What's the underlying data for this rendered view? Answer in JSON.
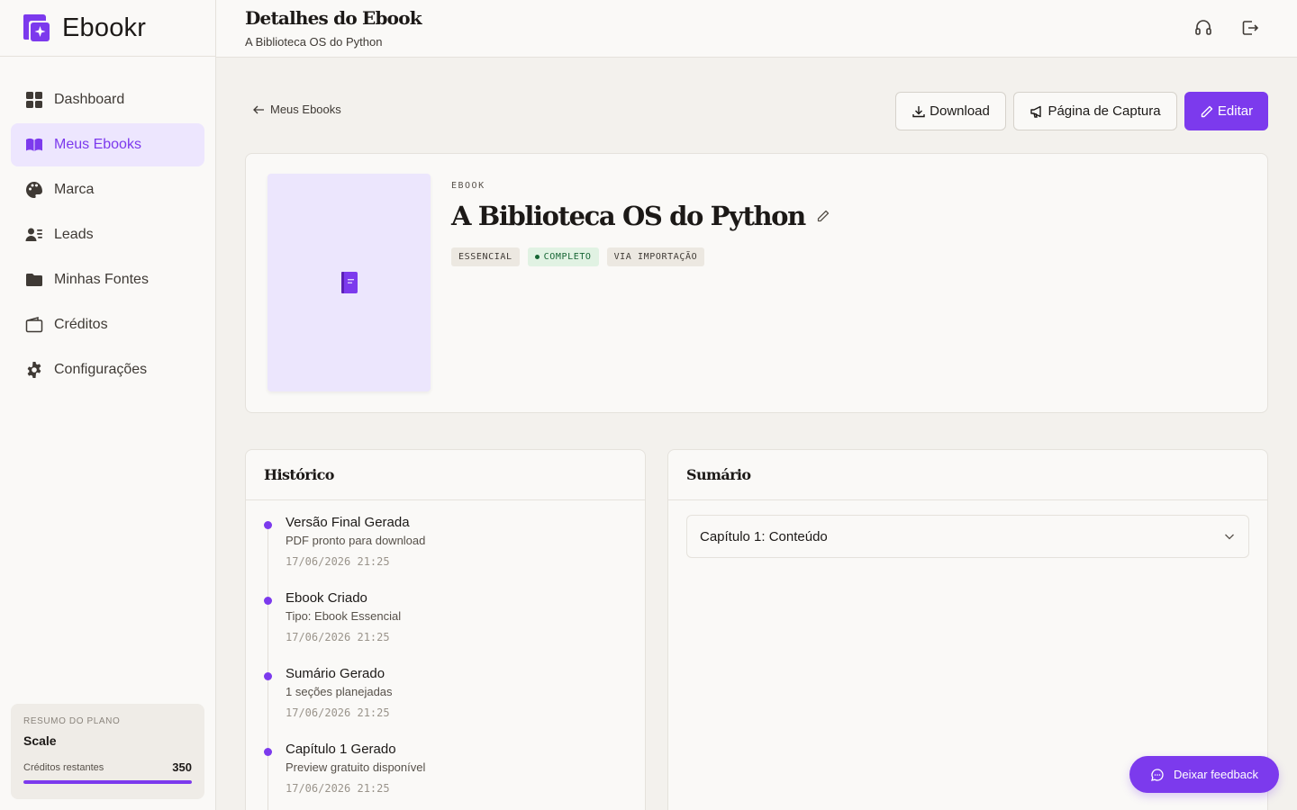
{
  "app": {
    "name": "Ebookr",
    "accent": "#7c3aed"
  },
  "sidebar": {
    "items": [
      {
        "label": "Dashboard",
        "icon": "dashboard-icon",
        "active": false
      },
      {
        "label": "Meus Ebooks",
        "icon": "book-icon",
        "active": true
      },
      {
        "label": "Marca",
        "icon": "palette-icon",
        "active": false
      },
      {
        "label": "Leads",
        "icon": "users-icon",
        "active": false
      },
      {
        "label": "Minhas Fontes",
        "icon": "folder-icon",
        "active": false
      },
      {
        "label": "Créditos",
        "icon": "wallet-icon",
        "active": false
      },
      {
        "label": "Configurações",
        "icon": "gear-icon",
        "active": false
      }
    ],
    "plan": {
      "label": "RESUMO DO PLANO",
      "name": "Scale",
      "credits_label": "Créditos restantes",
      "credits_value": "350",
      "credits_fill": 1.0
    }
  },
  "header": {
    "title": "Detalhes do Ebook",
    "subtitle": "A Biblioteca OS do Python",
    "icons": [
      "headset-icon",
      "logout-icon"
    ]
  },
  "toolbar": {
    "back_label": "Meus Ebooks",
    "download_label": "Download",
    "capture_label": "Página de Captura",
    "edit_label": "Editar"
  },
  "ebook": {
    "type_label": "EBOOK",
    "title": "A Biblioteca OS do Python",
    "badges": {
      "essential": "ESSENCIAL",
      "complete": "COMPLETO",
      "import": "VIA IMPORTAÇÃO"
    }
  },
  "history": {
    "title": "Histórico",
    "items": [
      {
        "title": "Versão Final Gerada",
        "desc": "PDF pronto para download",
        "time": "17/06/2026 21:25"
      },
      {
        "title": "Ebook Criado",
        "desc": "Tipo: Ebook Essencial",
        "time": "17/06/2026 21:25"
      },
      {
        "title": "Sumário Gerado",
        "desc": "1 seções planejadas",
        "time": "17/06/2026 21:25"
      },
      {
        "title": "Capítulo 1 Gerado",
        "desc": "Preview gratuito disponível",
        "time": "17/06/2026 21:25"
      }
    ]
  },
  "summary": {
    "title": "Sumário",
    "chapters": [
      {
        "label": "Capítulo 1: Conteúdo"
      }
    ]
  },
  "feedback": {
    "label": "Deixar feedback"
  }
}
